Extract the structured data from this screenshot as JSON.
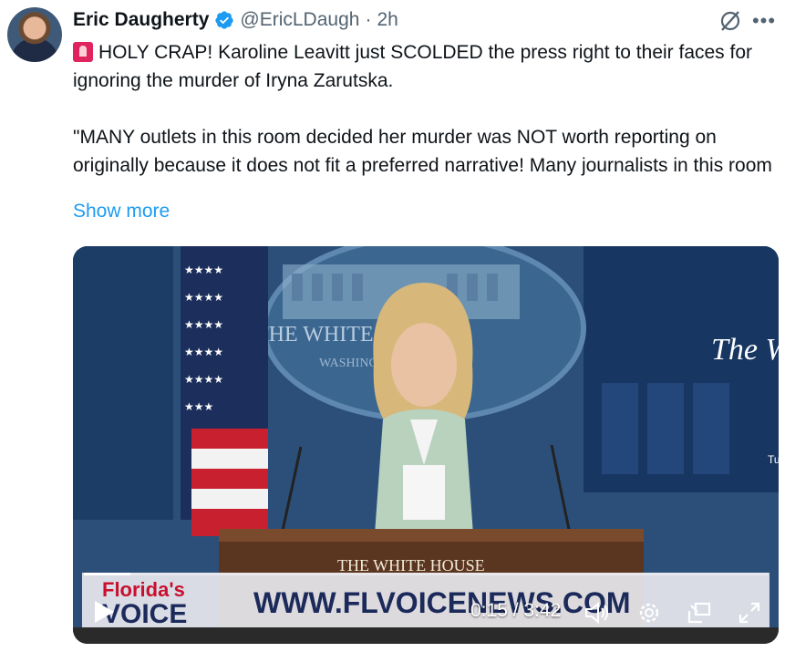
{
  "tweet": {
    "author_name": "Eric Daugherty",
    "handle": "@EricLDaugh",
    "separator": "·",
    "time": "2h",
    "text_line1": "HOLY CRAP! Karoline Leavitt just SCOLDED the press right to their faces for ignoring the murder of Iryna Zarutska.",
    "text_line2": "\"MANY outlets in this room decided her murder was NOT worth reporting on originally because it does not fit a preferred narrative! Many journalists in this room",
    "show_more": "Show more",
    "leading_icon": "rotating-light-icon"
  },
  "media": {
    "wall_seal_text": "THE WHITE HOUSE",
    "wall_seal_subtext": "WASHINGTON",
    "screen_text": "The W",
    "screen_small": "Tu",
    "podium_text": "THE WHITE HOUSE",
    "banner_logo_line1": "Florida's",
    "banner_logo_line2": "VOICE",
    "banner_url": "WWW.FLVOICENEWS.COM",
    "time_display": "0:15 / 3:42",
    "progress": 0.068,
    "colors": {
      "brand_red": "#c8102e",
      "banner_navy": "#1b2a5a"
    }
  },
  "icons": {
    "verified": "verified-badge-icon",
    "grok": "grok-icon",
    "more": "more-icon",
    "play": "play-icon",
    "volume": "volume-icon",
    "settings": "settings-icon",
    "pip": "picture-in-picture-icon",
    "fullscreen": "fullscreen-icon"
  }
}
